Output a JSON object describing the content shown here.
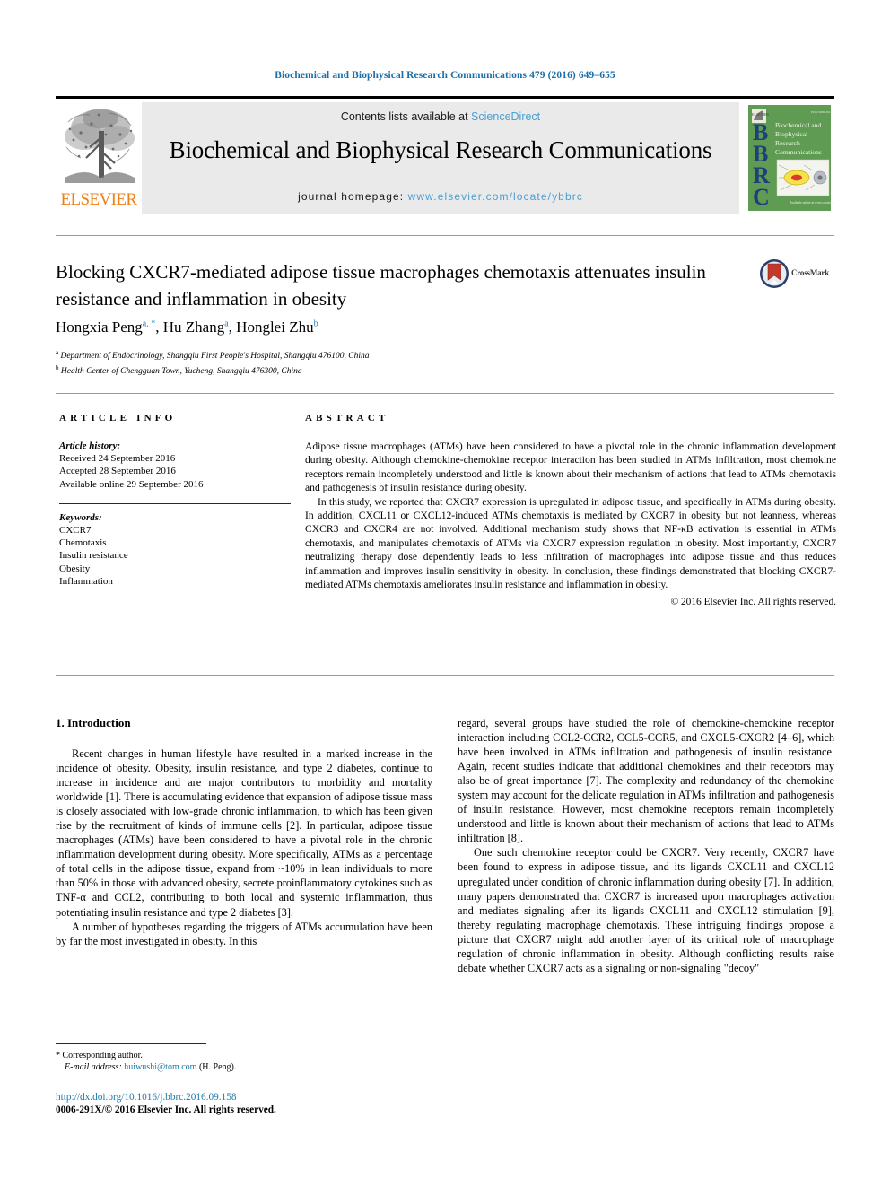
{
  "running_head": "Biochemical and Biophysical Research Communications 479 (2016) 649–655",
  "masthead": {
    "publisher_name": "ELSEVIER",
    "contents_prefix": "Contents lists available at ",
    "contents_link": "ScienceDirect",
    "journal_title": "Biochemical and Biophysical Research Communications",
    "homepage_prefix": "journal homepage: ",
    "homepage_link": "www.elsevier.com/locate/ybbrc",
    "cover": {
      "letters": "BBRC",
      "title_lines": [
        "Biochemical and",
        "Biophysical",
        "Research",
        "Communications"
      ],
      "top_right_note": "ISSN 0006-291X",
      "footer_note": "Available online at www.sciencedirect.com"
    }
  },
  "crossmark": {
    "label": "CrossMark"
  },
  "article": {
    "title": "Blocking CXCR7-mediated adipose tissue macrophages chemotaxis attenuates insulin resistance and inflammation in obesity",
    "authors": [
      {
        "name": "Hongxia Peng",
        "marks": "a, *"
      },
      {
        "name": "Hu Zhang",
        "marks": "a"
      },
      {
        "name": "Honglei Zhu",
        "marks": "b"
      }
    ],
    "affiliations": [
      {
        "mark": "a",
        "text": "Department of Endocrinology, Shangqiu First People's Hospital, Shangqiu 476100, China"
      },
      {
        "mark": "b",
        "text": "Health Center of Chengguan Town, Yucheng, Shangqiu 476300, China"
      }
    ]
  },
  "article_info": {
    "heading": "ARTICLE INFO",
    "history_label": "Article history:",
    "history": [
      "Received 24 September 2016",
      "Accepted 28 September 2016",
      "Available online 29 September 2016"
    ],
    "keywords_label": "Keywords:",
    "keywords": [
      "CXCR7",
      "Chemotaxis",
      "Insulin resistance",
      "Obesity",
      "Inflammation"
    ]
  },
  "abstract": {
    "heading": "ABSTRACT",
    "paragraph1": "Adipose tissue macrophages (ATMs) have been considered to have a pivotal role in the chronic inflammation development during obesity. Although chemokine-chemokine receptor interaction has been studied in ATMs infiltration, most chemokine receptors remain incompletely understood and little is known about their mechanism of actions that lead to ATMs chemotaxis and pathogenesis of insulin resistance during obesity.",
    "paragraph2": "In this study, we reported that CXCR7 expression is upregulated in adipose tissue, and specifically in ATMs during obesity. In addition, CXCL11 or CXCL12-induced ATMs chemotaxis is mediated by CXCR7 in obesity but not leanness, whereas CXCR3 and CXCR4 are not involved. Additional mechanism study shows that NF-κB activation is essential in ATMs chemotaxis, and manipulates chemotaxis of ATMs via CXCR7 expression regulation in obesity. Most importantly, CXCR7 neutralizing therapy dose dependently leads to less infiltration of macrophages into adipose tissue and thus reduces inflammation and improves insulin sensitivity in obesity. In conclusion, these findings demonstrated that blocking CXCR7-mediated ATMs chemotaxis ameliorates insulin resistance and inflammation in obesity.",
    "copyright": "© 2016 Elsevier Inc. All rights reserved."
  },
  "introduction": {
    "heading": "1. Introduction",
    "left_paragraphs": [
      "Recent changes in human lifestyle have resulted in a marked increase in the incidence of obesity. Obesity, insulin resistance, and type 2 diabetes, continue to increase in incidence and are major contributors to morbidity and mortality worldwide [1]. There is accumulating evidence that expansion of adipose tissue mass is closely associated with low-grade chronic inflammation, to which has been given rise by the recruitment of kinds of immune cells [2]. In particular, adipose tissue macrophages (ATMs) have been considered to have a pivotal role in the chronic inflammation development during obesity. More specifically, ATMs as a percentage of total cells in the adipose tissue, expand from ~10% in lean individuals to more than 50% in those with advanced obesity, secrete proinflammatory cytokines such as TNF-α and CCL2, contributing to both local and systemic inflammation, thus potentiating insulin resistance and type 2 diabetes [3].",
      "A number of hypotheses regarding the triggers of ATMs accumulation have been by far the most investigated in obesity. In this"
    ],
    "right_paragraphs": [
      "regard, several groups have studied the role of chemokine-chemokine receptor interaction including CCL2-CCR2, CCL5-CCR5, and CXCL5-CXCR2 [4–6], which have been involved in ATMs infiltration and pathogenesis of insulin resistance. Again, recent studies indicate that additional chemokines and their receptors may also be of great importance [7]. The complexity and redundancy of the chemokine system may account for the delicate regulation in ATMs infiltration and pathogenesis of insulin resistance. However, most chemokine receptors remain incompletely understood and little is known about their mechanism of actions that lead to ATMs infiltration [8].",
      "One such chemokine receptor could be CXCR7. Very recently, CXCR7 have been found to express in adipose tissue, and its ligands CXCL11 and CXCL12 upregulated under condition of chronic inflammation during obesity [7]. In addition, many papers demonstrated that CXCR7 is increased upon macrophages activation and mediates signaling after its ligands CXCL11 and CXCL12 stimulation [9], thereby regulating macrophage chemotaxis. These intriguing findings propose a picture that CXCR7 might add another layer of its critical role of macrophage regulation of chronic inflammation in obesity. Although conflicting results raise debate whether CXCR7 acts as a signaling or non-signaling \"decoy\""
    ]
  },
  "footer": {
    "corresponding_star": "*",
    "corresponding_label": "Corresponding author.",
    "email_label": "E-mail address:",
    "email": "huiwushi@tom.com",
    "email_owner": "(H. Peng).",
    "doi": "http://dx.doi.org/10.1016/j.bbrc.2016.09.158",
    "issn_line": "0006-291X/© 2016 Elsevier Inc. All rights reserved."
  },
  "colors": {
    "link": "#1a7aa8",
    "masthead_link": "#4a9fd4",
    "elsevier_orange": "#f07f13",
    "cover_green": "#5f9b52",
    "cover_letter": "#1f3f7a"
  }
}
